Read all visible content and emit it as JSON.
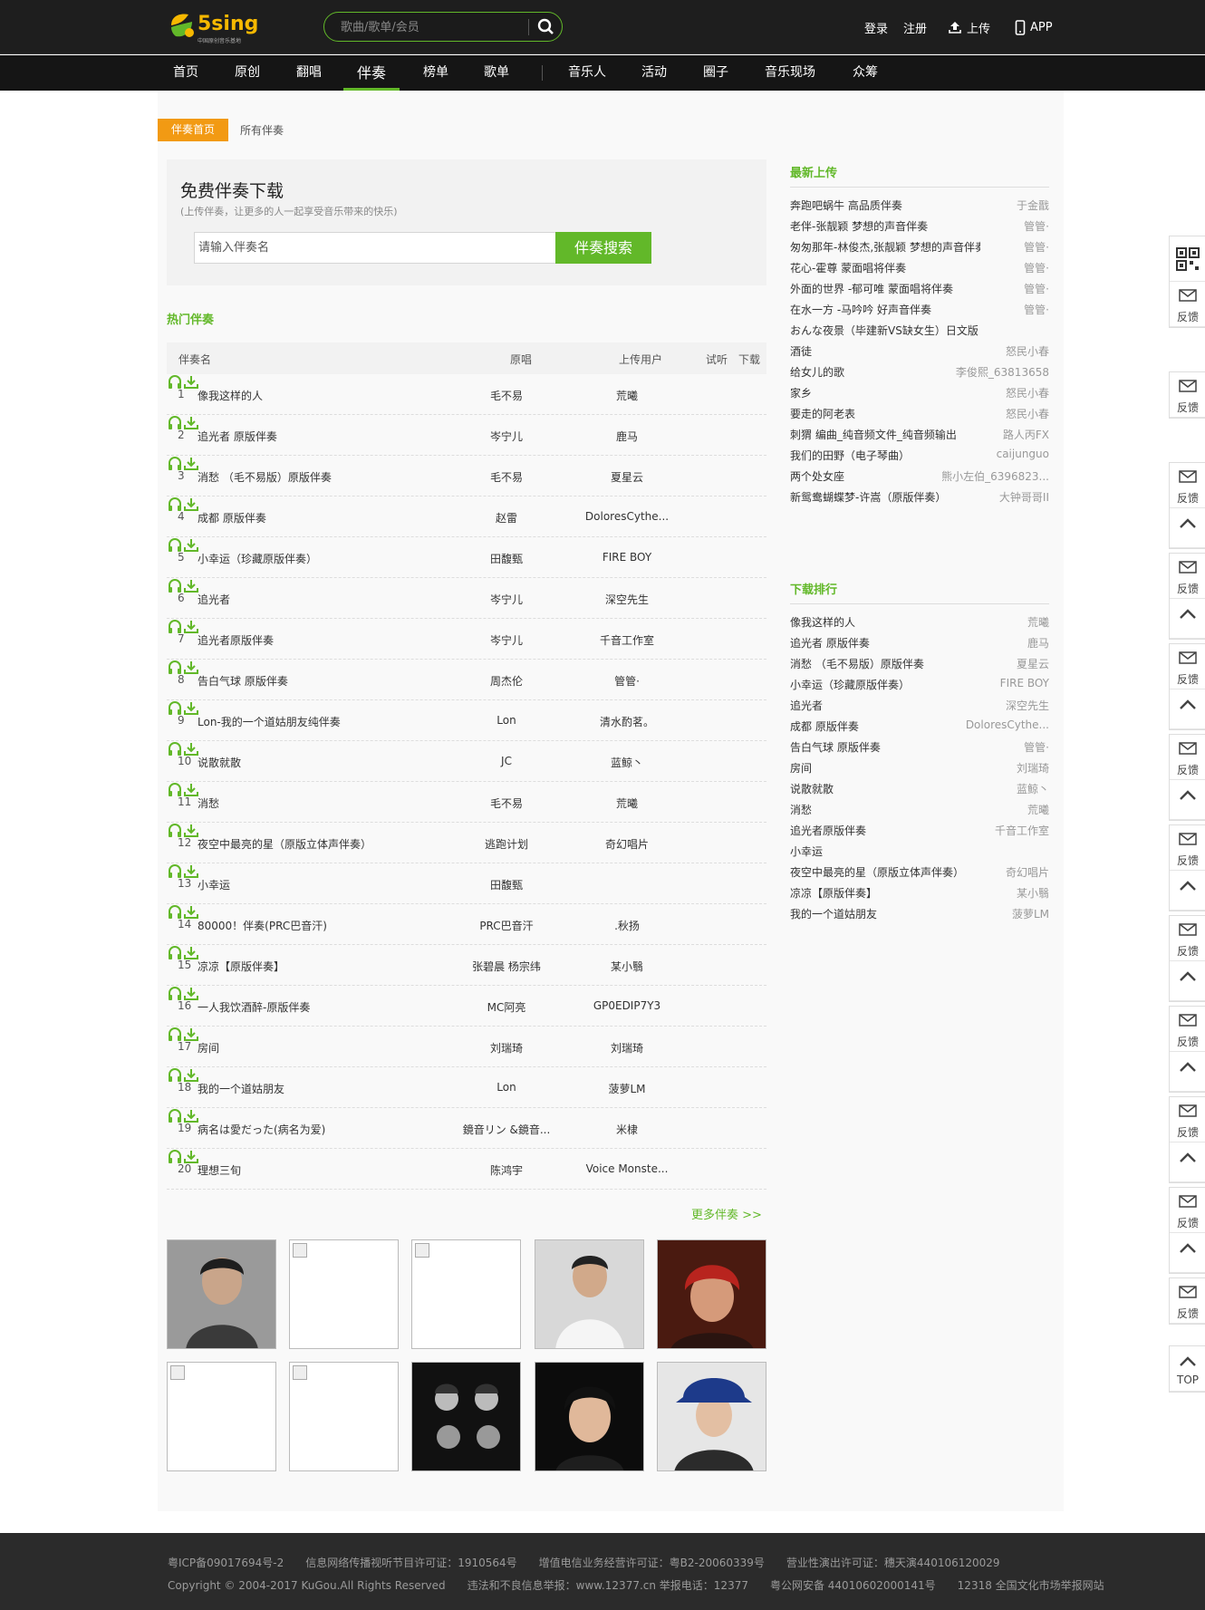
{
  "header": {
    "logo_text": "5sing",
    "logo_sub": "中国原创音乐基地",
    "search_placeholder": "歌曲/歌单/会员",
    "login": "登录",
    "register": "注册",
    "upload": "上传",
    "app": "APP"
  },
  "nav": [
    {
      "label": "首页"
    },
    {
      "label": "原创"
    },
    {
      "label": "翻唱"
    },
    {
      "label": "伴奏",
      "active": true
    },
    {
      "label": "榜单"
    },
    {
      "label": "歌单"
    },
    {
      "label": "音乐人"
    },
    {
      "label": "活动"
    },
    {
      "label": "圈子"
    },
    {
      "label": "音乐现场"
    },
    {
      "label": "众筹"
    }
  ],
  "breadcrumb": {
    "home": "伴奏首页",
    "all": "所有伴奏"
  },
  "search_box": {
    "title": "免费伴奏下载",
    "subtitle": "(上传伴奏，让更多的人一起享受音乐带来的快乐)",
    "placeholder": "请输入伴奏名",
    "button": "伴奏搜索"
  },
  "hot": {
    "title": "热门伴奏",
    "columns": [
      "伴奏名",
      "原唱",
      "上传用户",
      "试听",
      "下载"
    ],
    "rows": [
      {
        "n": "1",
        "name": "像我这样的人",
        "artist": "毛不易",
        "user": "荒曦"
      },
      {
        "n": "2",
        "name": "追光者 原版伴奏",
        "artist": "岑宁儿",
        "user": "鹿马"
      },
      {
        "n": "3",
        "name": "消愁 （毛不易版）原版伴奏",
        "artist": "毛不易",
        "user": "夏星云"
      },
      {
        "n": "4",
        "name": "成都 原版伴奏",
        "artist": "赵雷",
        "user": "DoloresCythe..."
      },
      {
        "n": "5",
        "name": "小幸运（珍藏原版伴奏）",
        "artist": "田馥甄",
        "user": "FIRE BOY"
      },
      {
        "n": "6",
        "name": "追光者",
        "artist": "岑宁儿",
        "user": "深空先生"
      },
      {
        "n": "7",
        "name": "追光者原版伴奏",
        "artist": "岑宁儿",
        "user": "千音工作室"
      },
      {
        "n": "8",
        "name": "告白气球 原版伴奏",
        "artist": "周杰伦",
        "user": "管管·"
      },
      {
        "n": "9",
        "name": "Lon-我的一个道姑朋友纯伴奏",
        "artist": "Lon",
        "user": "清水酌茗。"
      },
      {
        "n": "10",
        "name": "说散就散",
        "artist": "JC",
        "user": "蓝鲸丶"
      },
      {
        "n": "11",
        "name": "消愁",
        "artist": "毛不易",
        "user": "荒曦"
      },
      {
        "n": "12",
        "name": "夜空中最亮的星（原版立体声伴奏）",
        "artist": "逃跑计划",
        "user": "奇幻唱片"
      },
      {
        "n": "13",
        "name": "小幸运",
        "artist": "田馥甄",
        "user": ""
      },
      {
        "n": "14",
        "name": "80000！伴奏(PRC巴音汗)",
        "artist": "PRC巴音汗",
        "user": ".秋扬"
      },
      {
        "n": "15",
        "name": "凉凉【原版伴奏】",
        "artist": "张碧晨 杨宗纬",
        "user": "某小翳"
      },
      {
        "n": "16",
        "name": "一人我饮酒醉-原版伴奏",
        "artist": "MC阿亮",
        "user": "GP0EDIP7Y3"
      },
      {
        "n": "17",
        "name": "房间",
        "artist": "刘瑞琦",
        "user": "刘瑞琦"
      },
      {
        "n": "18",
        "name": "我的一个道姑朋友",
        "artist": "Lon",
        "user": "菠萝LM"
      },
      {
        "n": "19",
        "name": "病名は愛だった(病名为爱)",
        "artist": "鏡音リン &鏡音...",
        "user": "米棣"
      },
      {
        "n": "20",
        "name": "理想三旬",
        "artist": "陈鸿宇",
        "user": "Voice Monste..."
      }
    ],
    "more": "更多伴奏 >>"
  },
  "latest": {
    "title": "最新上传",
    "items": [
      {
        "t": "奔跑吧蜗牛 高品质伴奏",
        "u": "于金戬"
      },
      {
        "t": "老伴-张靓颖 梦想的声音伴奏",
        "u": "管管·"
      },
      {
        "t": "匆匆那年-林俊杰,张靓颖 梦想的声音伴奏",
        "u": "管管·"
      },
      {
        "t": "花心-霍尊 蒙面唱将伴奏",
        "u": "管管·"
      },
      {
        "t": "外面的世界 -郁可唯 蒙面唱将伴奏",
        "u": "管管·"
      },
      {
        "t": "在水一方 -马吟吟 好声音伴奏",
        "u": "管管·"
      },
      {
        "t": "おんな夜景（毕建新VS缺女生）日文版",
        "u": ""
      },
      {
        "t": "酒徒",
        "u": "怒民小春"
      },
      {
        "t": "给女儿的歌",
        "u": "李俊熙_63813658"
      },
      {
        "t": "家乡",
        "u": "怒民小春"
      },
      {
        "t": "要走的阿老表",
        "u": "怒民小春"
      },
      {
        "t": "刺猬 编曲_纯音频文件_纯音频输出",
        "u": "路人丙FX"
      },
      {
        "t": "我们的田野（电子琴曲）",
        "u": "caijunguo"
      },
      {
        "t": "两个处女座",
        "u": "熊小左伯_6396823..."
      },
      {
        "t": "新鸳鸯蝴蝶梦-许嵩（原版伴奏）",
        "u": "大钟哥哥II"
      }
    ]
  },
  "ranking": {
    "title": "下载排行",
    "items": [
      {
        "t": "像我这样的人",
        "u": "荒曦"
      },
      {
        "t": "追光者 原版伴奏",
        "u": "鹿马"
      },
      {
        "t": "消愁 （毛不易版）原版伴奏",
        "u": "夏星云"
      },
      {
        "t": "小幸运（珍藏原版伴奏）",
        "u": "FIRE BOY"
      },
      {
        "t": "追光者",
        "u": "深空先生"
      },
      {
        "t": "成都 原版伴奏",
        "u": "DoloresCythe..."
      },
      {
        "t": "告白气球 原版伴奏",
        "u": "管管·"
      },
      {
        "t": "房间",
        "u": "刘瑞琦"
      },
      {
        "t": "说散就散",
        "u": "蓝鲸丶"
      },
      {
        "t": "消愁",
        "u": "荒曦"
      },
      {
        "t": "追光者原版伴奏",
        "u": "千音工作室"
      },
      {
        "t": "小幸运",
        "u": ""
      },
      {
        "t": "夜空中最亮的星（原版立体声伴奏）",
        "u": "奇幻唱片"
      },
      {
        "t": "凉凉【原版伴奏】",
        "u": "某小翳"
      },
      {
        "t": "我的一个道姑朋友",
        "u": "菠萝LM"
      }
    ]
  },
  "rail": {
    "feedback": "反馈",
    "top": "TOP"
  },
  "footer": {
    "line1": "粤ICP备09017694号-2　　信息网络传播视听节目许可证：1910564号　　增值电信业务经营许可证：粤B2-20060339号　　营业性演出许可证：穗天演440106120029",
    "line2": "Copyright © 2004-2017 KuGou.All Rights Reserved　　违法和不良信息举报：www.12377.cn 举报电话：12377　　粤公网安备 44010602000141号　　12318 全国文化市场举报网站"
  },
  "colors": {
    "accent": "#62b829",
    "orange": "#f29a13",
    "topbar": "#1e1e1e",
    "footer": "#2b2b2b"
  }
}
